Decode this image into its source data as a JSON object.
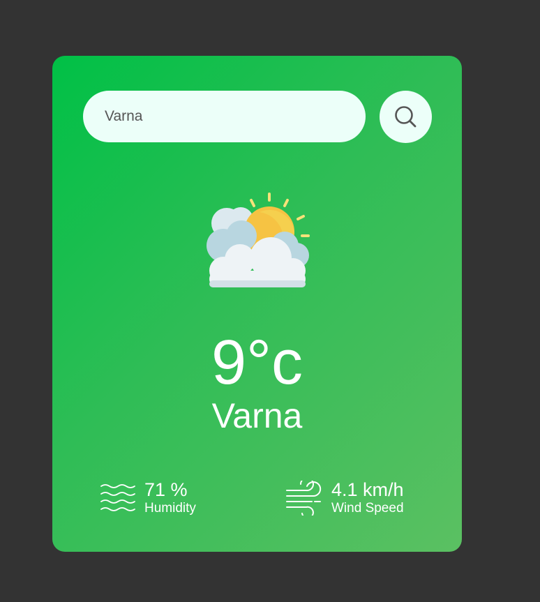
{
  "search": {
    "value": "Varna",
    "icon": "search-icon"
  },
  "weather": {
    "icon": "partly-cloudy-icon",
    "temperature": "9°c",
    "city": "Varna"
  },
  "details": {
    "humidity": {
      "icon": "humidity-icon",
      "value": "71 %",
      "label": "Humidity"
    },
    "wind": {
      "icon": "wind-icon",
      "value": "4.1 km/h",
      "label": "Wind Speed"
    }
  },
  "colors": {
    "page_background": "#333333",
    "card_gradient_start": "#00c046",
    "card_gradient_end": "#5bc062",
    "input_background": "#ecfff9",
    "text": "#ffffff"
  }
}
